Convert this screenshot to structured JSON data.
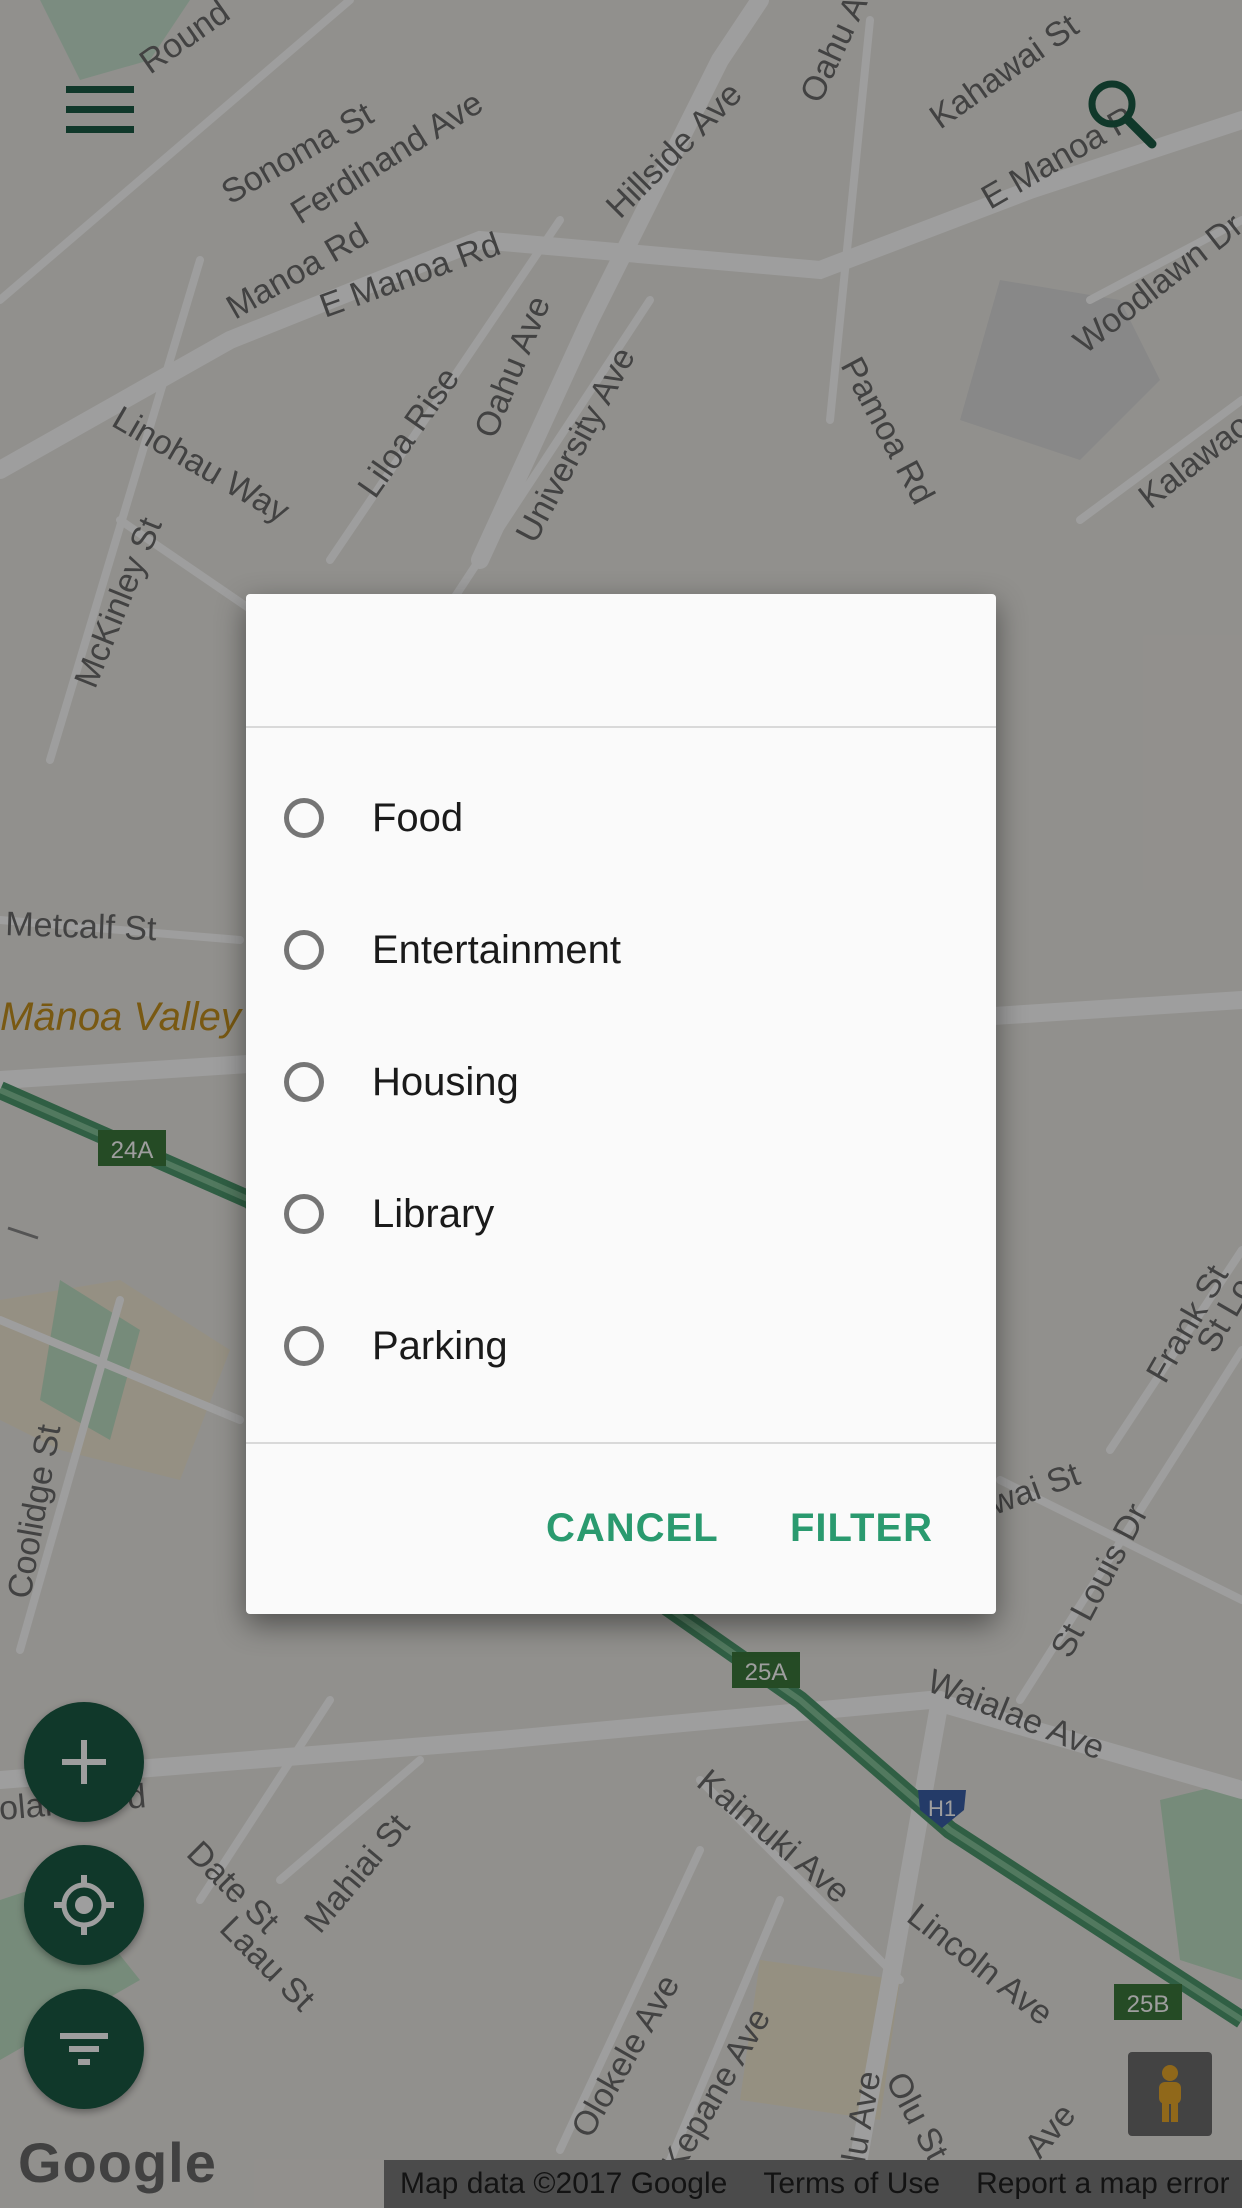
{
  "map": {
    "streets": [
      "Round",
      "Sonoma St",
      "Ferdinand Ave",
      "Manoa Rd",
      "E Manoa Rd",
      "Hillside Ave",
      "Oahu Av",
      "Kahawai St",
      "E Manoa R",
      "Woodlawn Dr",
      "Kalawao",
      "Linohau Way",
      "Liloa Rise",
      "Oahu Ave",
      "University Ave",
      "Pamoa Rd",
      "McKinley St",
      "Metcalf St",
      "Frank St",
      "St Lo",
      "Coolidge St",
      "Waialae Ave",
      "St Louis Dr",
      "Kaimuki Ave",
      "Lincoln Ave",
      "Date St",
      "Mahiai St",
      "Laau St",
      "Olokele Ave",
      "Kepane Ave",
      "Olu St",
      "olani Blvd",
      "lulu Ave",
      "Ave",
      "wai St"
    ],
    "place_label": "Mānoa Valley",
    "exit_badges": [
      "24A",
      "25A",
      "25B",
      "H1"
    ],
    "google_logo": "Google",
    "attribution": {
      "map_data": "Map data ©2017 Google",
      "terms": "Terms of Use",
      "report": "Report a map error"
    }
  },
  "toolbar": {
    "menu_icon": "hamburger-menu-icon",
    "search_icon": "search-icon"
  },
  "fabs": [
    {
      "icon": "plus-icon"
    },
    {
      "icon": "crosshair-icon"
    },
    {
      "icon": "filter-icon"
    }
  ],
  "dialog": {
    "title": "",
    "options": [
      {
        "label": "Food",
        "selected": false
      },
      {
        "label": "Entertainment",
        "selected": false
      },
      {
        "label": "Housing",
        "selected": false
      },
      {
        "label": "Library",
        "selected": false
      },
      {
        "label": "Parking",
        "selected": false
      }
    ],
    "cancel_label": "CANCEL",
    "filter_label": "FILTER"
  },
  "colors": {
    "accent": "#2a9a6f",
    "fab": "#1a5b44",
    "dialog_bg": "#fafafa"
  }
}
